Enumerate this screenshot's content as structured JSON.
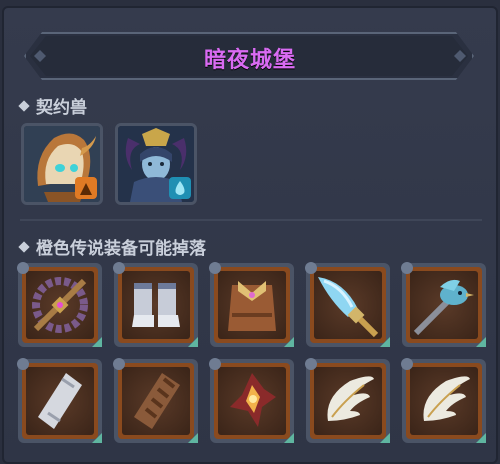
{
  "title": "暗夜城堡",
  "contract_beasts": {
    "label": "契约兽",
    "items": [
      {
        "name": "contract-beast-1",
        "element_icon": "fire-element-icon",
        "element_color": "#e07a24"
      },
      {
        "name": "contract-beast-2",
        "element_icon": "water-element-icon",
        "element_color": "#1f8fb3"
      }
    ]
  },
  "drops": {
    "label": "橙色传说装备可能掉落",
    "rarity_color": "#c0581f",
    "items": [
      {
        "icon": "ring-blade-weapon-icon"
      },
      {
        "icon": "boots-icon"
      },
      {
        "icon": "armor-icon"
      },
      {
        "icon": "crystal-sword-icon"
      },
      {
        "icon": "bird-scepter-icon"
      },
      {
        "icon": "bracer-icon"
      },
      {
        "icon": "wrapped-bracer-icon"
      },
      {
        "icon": "flame-shard-icon"
      },
      {
        "icon": "wing-icon"
      },
      {
        "icon": "wing-icon"
      }
    ]
  }
}
